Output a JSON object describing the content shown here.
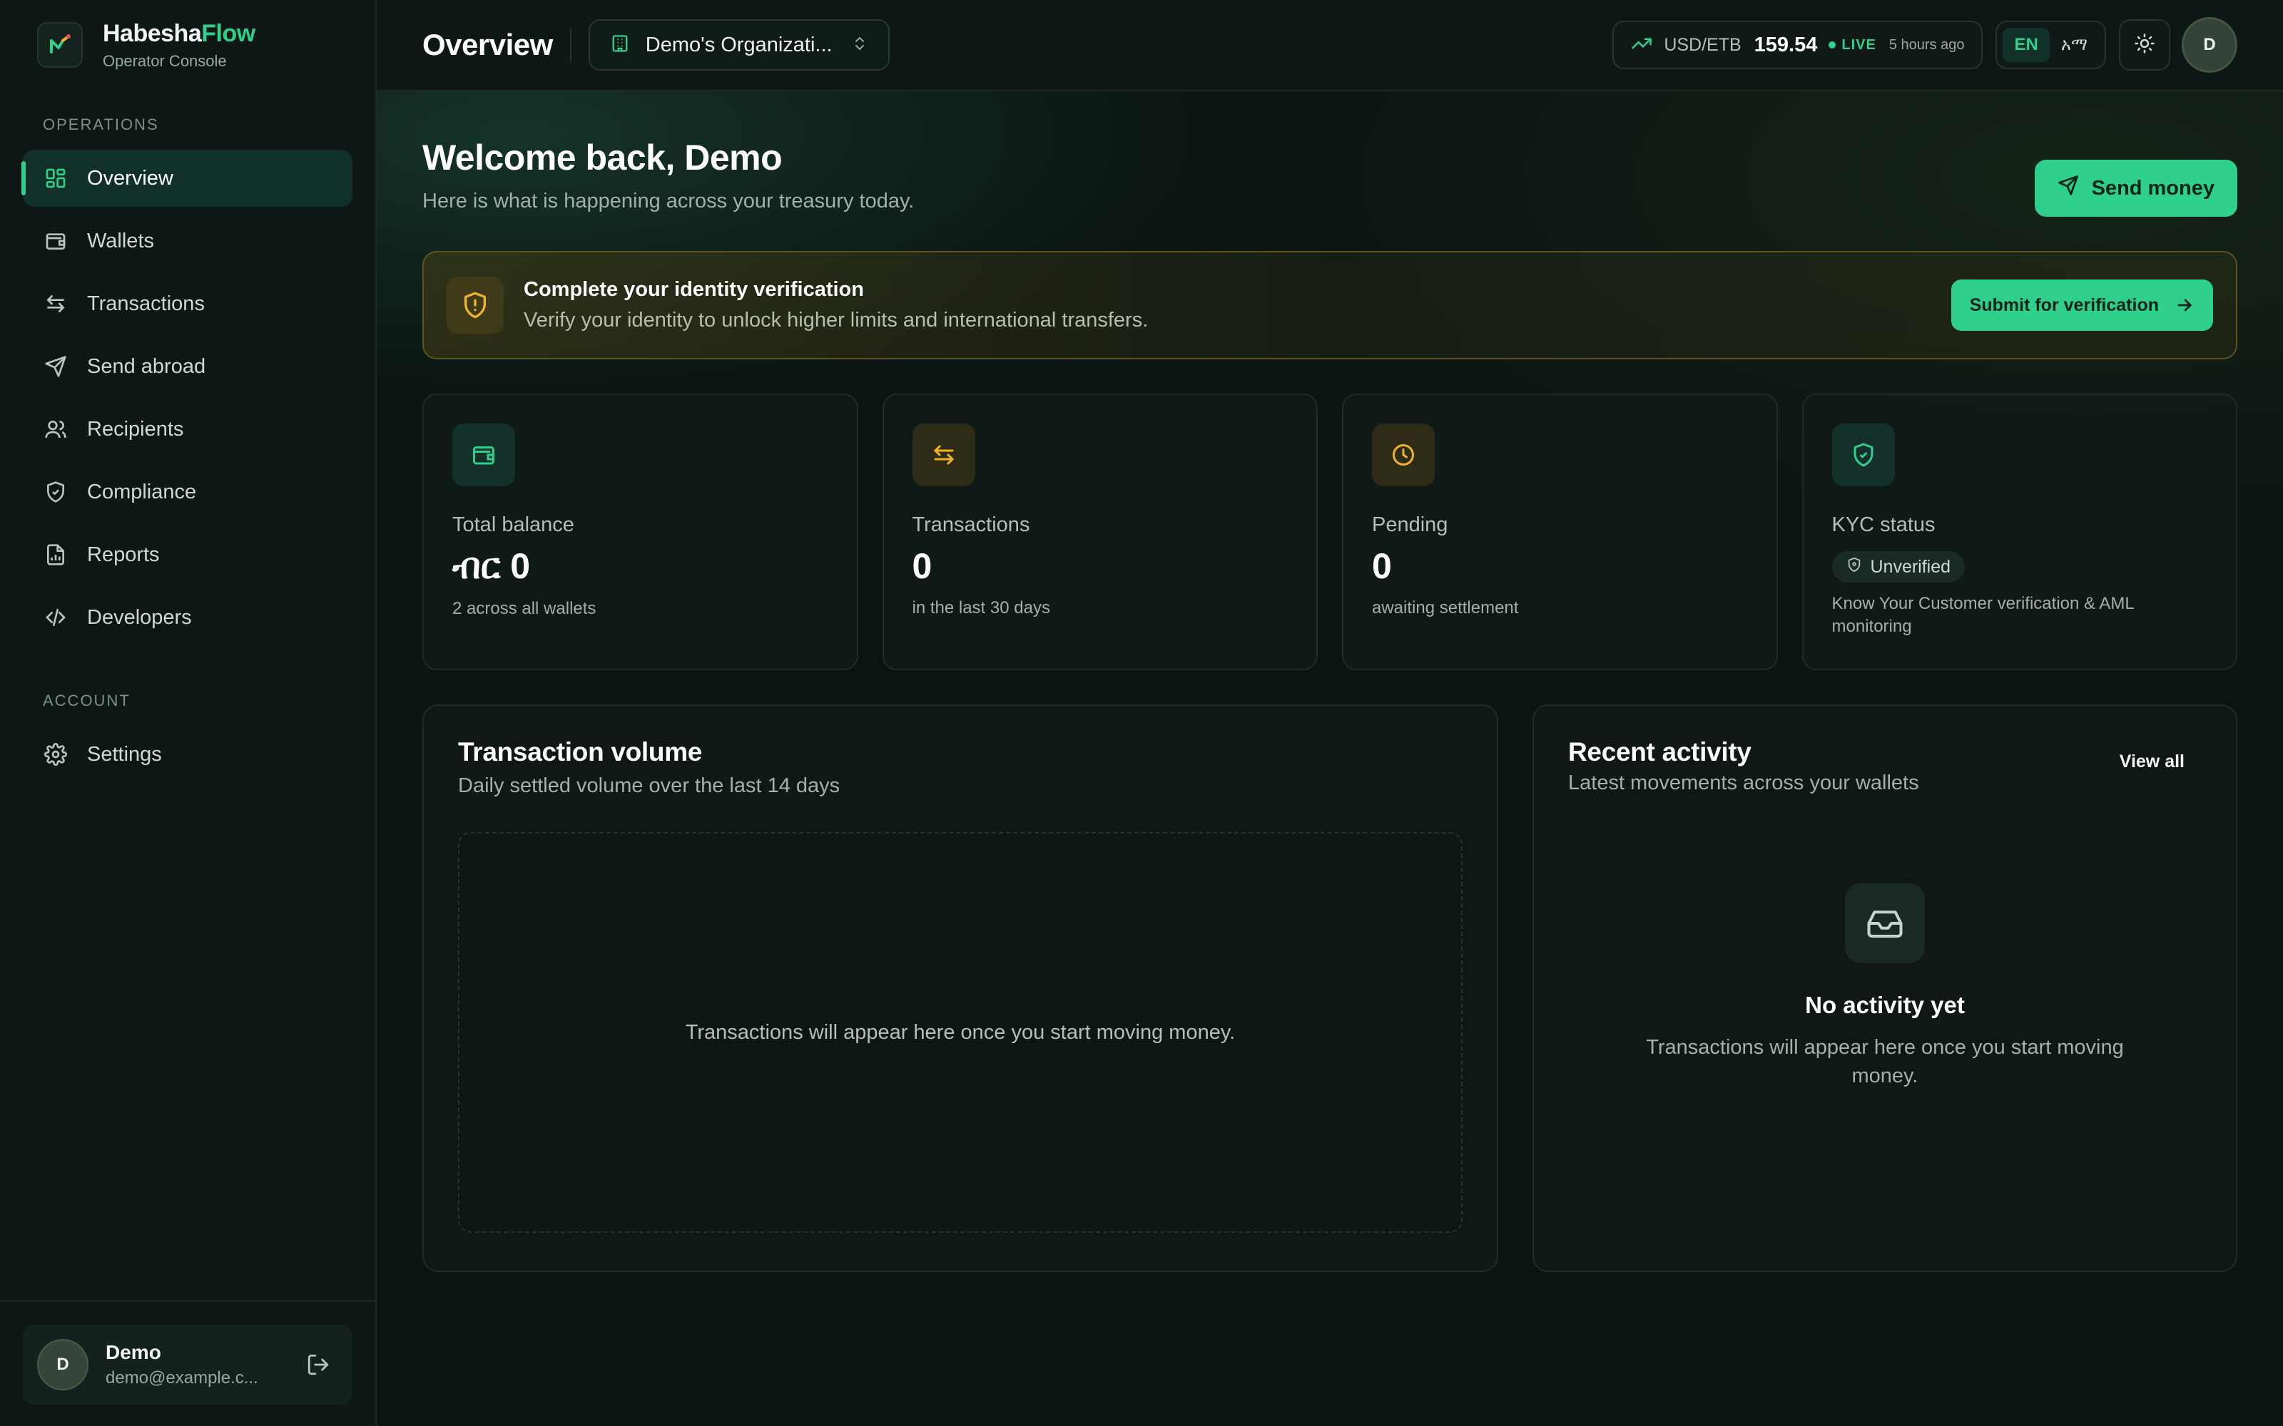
{
  "brand": {
    "name_main": "Habesha",
    "name_accent": "Flow",
    "subtitle": "Operator Console"
  },
  "sidebar": {
    "sections": [
      {
        "label": "OPERATIONS",
        "items": [
          {
            "label": "Overview",
            "icon": "grid-icon",
            "active": true
          },
          {
            "label": "Wallets",
            "icon": "wallet-icon"
          },
          {
            "label": "Transactions",
            "icon": "arrows-swap-icon"
          },
          {
            "label": "Send abroad",
            "icon": "send-icon"
          },
          {
            "label": "Recipients",
            "icon": "users-icon"
          },
          {
            "label": "Compliance",
            "icon": "shield-check-icon"
          },
          {
            "label": "Reports",
            "icon": "report-icon"
          },
          {
            "label": "Developers",
            "icon": "code-icon"
          }
        ]
      },
      {
        "label": "ACCOUNT",
        "items": [
          {
            "label": "Settings",
            "icon": "gear-icon"
          }
        ]
      }
    ],
    "user": {
      "initial": "D",
      "name": "Demo",
      "email": "demo@example.c..."
    }
  },
  "topbar": {
    "title": "Overview",
    "org": "Demo's Organizati...",
    "fx": {
      "pair": "USD/ETB",
      "rate": "159.54",
      "live": "LIVE",
      "updated": "5 hours ago"
    },
    "lang": {
      "en": "EN",
      "am": "አማ"
    },
    "avatar_initial": "D"
  },
  "welcome": {
    "title": "Welcome back, Demo",
    "subtitle": "Here is what is happening across your treasury today.",
    "send_button": "Send money"
  },
  "verify": {
    "title": "Complete your identity verification",
    "description": "Verify your identity to unlock higher limits and international transfers.",
    "button": "Submit for verification"
  },
  "stats": [
    {
      "label": "Total balance",
      "value": "ብር 0",
      "sub": "2 across all wallets",
      "icon": "wallet-icon"
    },
    {
      "label": "Transactions",
      "value": "0",
      "sub": "in the last 30 days",
      "icon": "arrows-swap-icon"
    },
    {
      "label": "Pending",
      "value": "0",
      "sub": "awaiting settlement",
      "icon": "clock-icon"
    },
    {
      "label": "KYC status",
      "badge": "Unverified",
      "sub": "Know Your Customer verification & AML monitoring",
      "icon": "shield-check-icon"
    }
  ],
  "volume": {
    "title": "Transaction volume",
    "subtitle": "Daily settled volume over the last 14 days",
    "empty": "Transactions will appear here once you start moving money."
  },
  "activity": {
    "title": "Recent activity",
    "subtitle": "Latest movements across your wallets",
    "view_all": "View all",
    "empty_title": "No activity yet",
    "empty_desc": "Transactions will appear here once you start moving money."
  },
  "colors": {
    "accent": "#2fd08c",
    "warning": "#f0b429",
    "background": "#0b1412"
  }
}
